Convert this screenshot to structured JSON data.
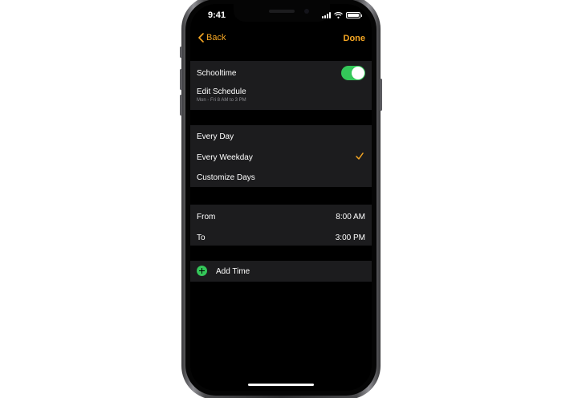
{
  "status_bar": {
    "time": "9:41"
  },
  "nav": {
    "back_label": "Back",
    "done_label": "Done"
  },
  "schedule": {
    "toggle_label": "Schooltime",
    "toggle_on": true,
    "edit_label": "Edit Schedule",
    "edit_sub": "Mon - Fri 8 AM to 3 PM"
  },
  "days": {
    "options": [
      "Every Day",
      "Every Weekday",
      "Customize Days"
    ],
    "selected": "Every Weekday"
  },
  "time_range": {
    "from_label": "From",
    "from_value": "8:00 AM",
    "to_label": "To",
    "to_value": "3:00 PM"
  },
  "add_time": {
    "label": "Add Time"
  },
  "colors": {
    "accent": "#f5a623",
    "toggle_on": "#34c759",
    "add_icon": "#34c759",
    "group_bg": "#1c1c1e",
    "screen_bg": "#000000"
  },
  "icons": [
    "chevron-left-icon",
    "checkmark-icon",
    "plus-circle-icon",
    "signal-icon",
    "wifi-icon",
    "battery-icon"
  ]
}
